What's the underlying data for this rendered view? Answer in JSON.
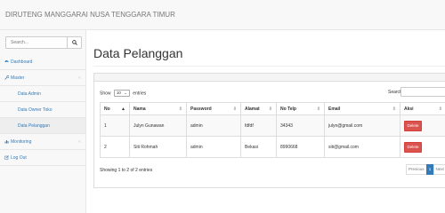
{
  "brand": "DIRUTENG MANGGARAI NUSA TENGGARA TIMUR",
  "sidebar": {
    "search_placeholder": "Search...",
    "items": [
      {
        "label": "Dashboard",
        "icon": "dashboard-icon"
      },
      {
        "label": "Master",
        "icon": "wrench-icon"
      },
      {
        "label": "Data Admin"
      },
      {
        "label": "Data Owner Toko"
      },
      {
        "label": "Data Pelanggan"
      },
      {
        "label": "Monitoring",
        "icon": "chart-icon"
      },
      {
        "label": "Log Out",
        "icon": "edit-icon"
      }
    ]
  },
  "main": {
    "title": "Data Pelanggan",
    "show_prefix": "Show",
    "show_value": "10",
    "show_suffix": "entries",
    "search_label": "Search:",
    "columns": [
      "No",
      "Nama",
      "Password",
      "Alamat",
      "No Telp",
      "Email",
      "Aksi"
    ],
    "rows": [
      {
        "no": "1",
        "nama": "Julyn Gunawan",
        "password": "admin",
        "alamat": "fdfdf",
        "telp": "34343",
        "email": "julyn@gmail.com",
        "action": "Delete"
      },
      {
        "no": "2",
        "nama": "Siti Rohmah",
        "password": "admin",
        "alamat": "Bekasi",
        "telp": "8990668",
        "email": "siti@gmail.com",
        "action": "Delete"
      }
    ],
    "info": "Showing 1 to 2 of 2 entries",
    "pagination": {
      "previous": "Previous",
      "current": "1",
      "next": "Next"
    }
  },
  "colors": {
    "link": "#337ab7",
    "danger": "#d9534f",
    "topbar": "#f8f8f8"
  }
}
